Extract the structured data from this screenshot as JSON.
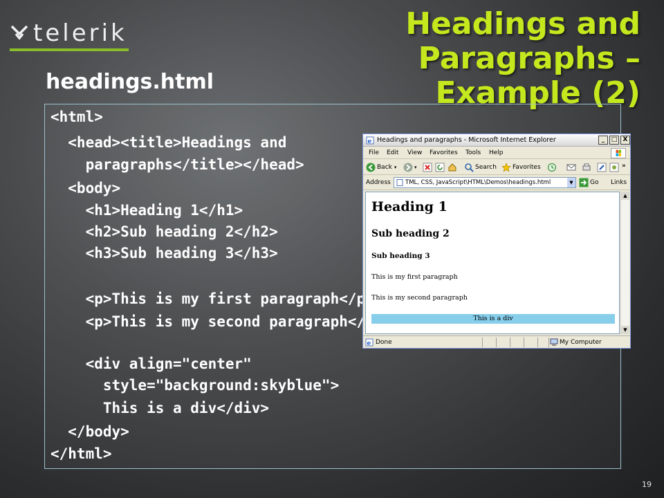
{
  "logo": {
    "text": "telerik",
    "mark": "telerik-logo-mark"
  },
  "title": {
    "line1": "Headings and Paragraphs –",
    "line2": "Example (2)"
  },
  "subtitle": "headings.html",
  "code_lines": [
    "<html>",
    "  <head><title>Headings and",
    "    paragraphs</title></head>",
    "  <body>",
    "    <h1>Heading 1</h1>",
    "    <h2>Sub heading 2</h2>",
    "    <h3>Sub heading 3</h3>",
    "",
    "    <p>This is my first paragraph</p>",
    "    <p>This is my second paragraph</p>",
    "",
    "    <div align=\"center\"",
    "      style=\"background:skyblue\">",
    "      This is a div</div>",
    "  </body>",
    "</html>"
  ],
  "browser": {
    "window_title": "Headings and paragraphs - Microsoft Internet Explorer",
    "window_buttons": {
      "minimize": "_",
      "maximize": "□",
      "close": "X"
    },
    "menu": [
      "File",
      "Edit",
      "View",
      "Favorites",
      "Tools",
      "Help"
    ],
    "toolbar": {
      "back": "Back",
      "search": "Search",
      "favorites": "Favorites"
    },
    "address_label": "Address",
    "address_value": "TML, CSS, JavaScript\\HTML\\Demos\\headings.html",
    "go_label": "Go",
    "links_label": "Links",
    "page": {
      "h1": "Heading 1",
      "h2": "Sub heading 2",
      "h3": "Sub heading 3",
      "p1": "This is my first paragraph",
      "p2": "This is my second paragraph",
      "div": "This is a div"
    },
    "status_text": "Done",
    "zone_text": "My Computer"
  },
  "page_number": "19",
  "colors": {
    "title": "#c4e81e",
    "accent_bar": "#8bbd2a",
    "div_bg": "#87ceeb"
  }
}
